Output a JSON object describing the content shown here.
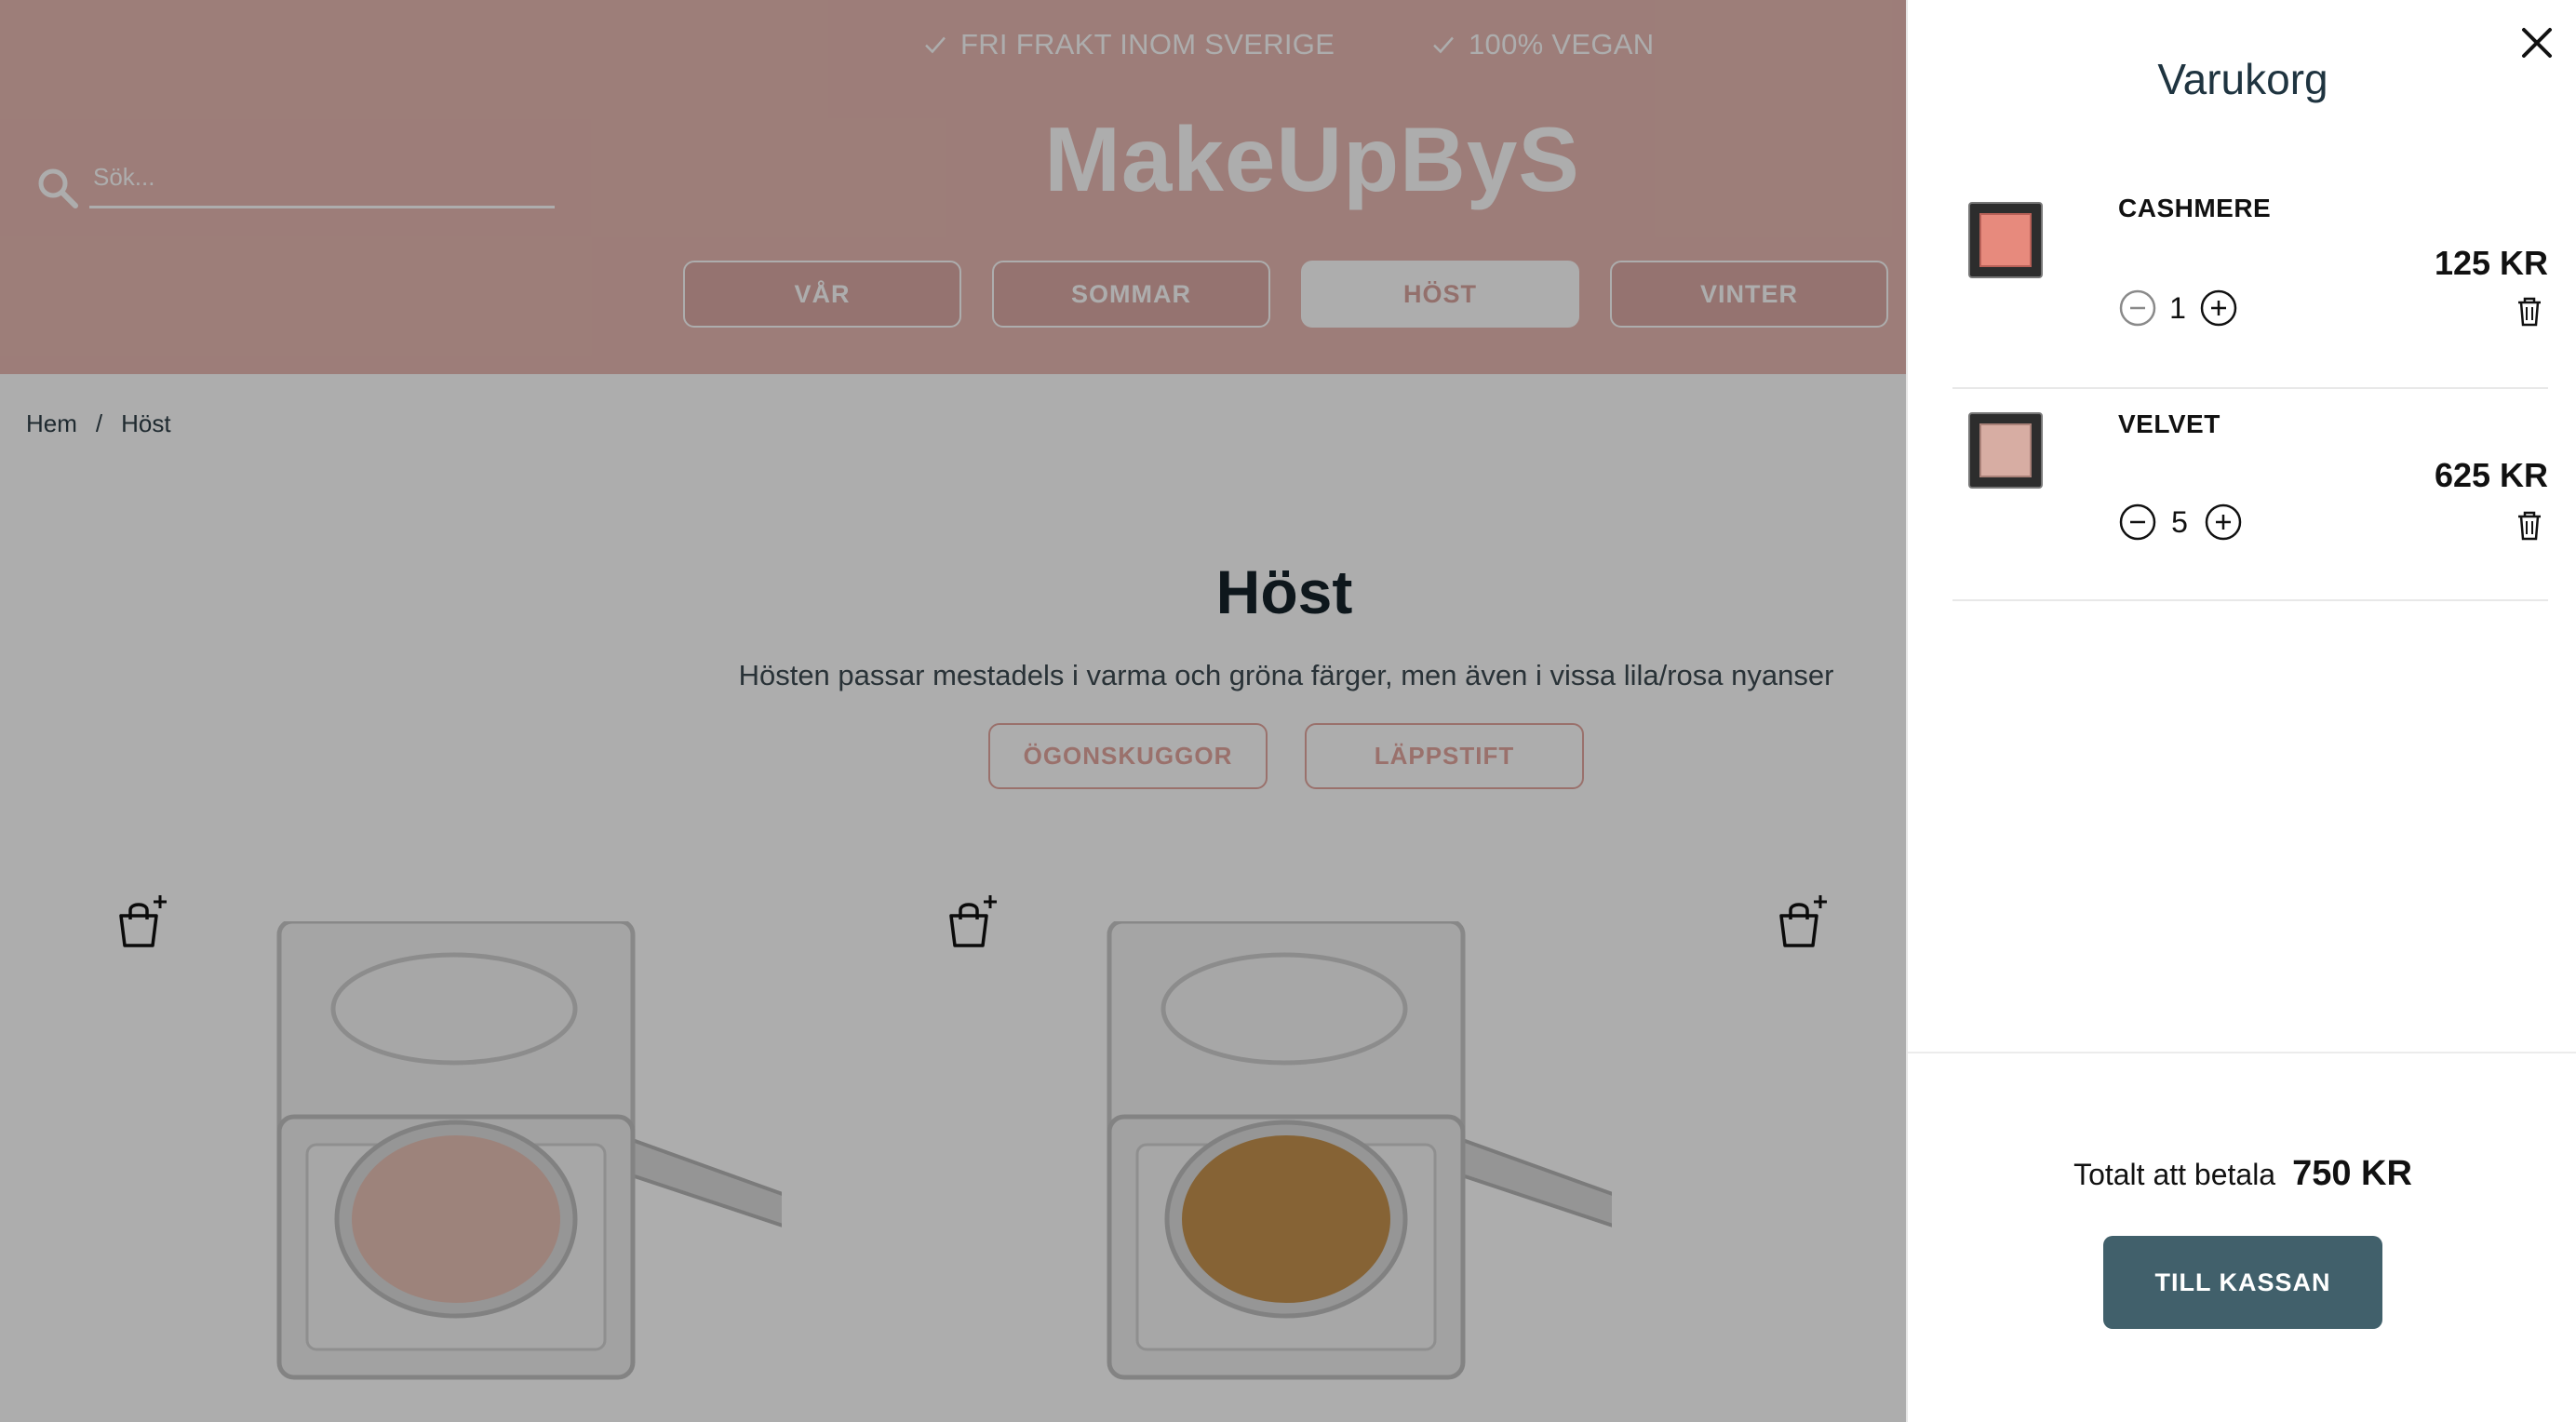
{
  "colors": {
    "header_pink": "#e8b9b3",
    "accent_pink": "#e4a79f",
    "checkout_teal": "#41606b",
    "overlay": "rgba(0,0,0,0.32)"
  },
  "header": {
    "usp": [
      {
        "icon": "check-icon",
        "text": "FRI FRAKT INOM SVERIGE"
      },
      {
        "icon": "check-icon",
        "text": "100% VEGAN"
      }
    ],
    "search_placeholder": "Sök...",
    "logo": "MakeUpByS",
    "seasons": [
      "VÅR",
      "SOMMAR",
      "HÖST",
      "VINTER"
    ],
    "active_season": "HÖST"
  },
  "breadcrumb": {
    "home": "Hem",
    "separator": "/",
    "current": "Höst"
  },
  "main": {
    "title": "Höst",
    "description": "Hösten passar mestadels i varma och gröna färger, men även i vissa lila/rosa nyanser",
    "categories": [
      "ÖGONSKUGGOR",
      "LÄPPSTIFT"
    ],
    "products": [
      {
        "icon": "add-to-bag-icon",
        "pan_color": "#e8c2b6"
      },
      {
        "icon": "add-to-bag-icon",
        "pan_color": "#c6924e"
      },
      {
        "icon": "add-to-bag-icon"
      }
    ]
  },
  "cart": {
    "title": "Varukorg",
    "items": [
      {
        "name": "CASHMERE",
        "price": "125 KR",
        "qty": "1",
        "swatch": "#e78a7d"
      },
      {
        "name": "VELVET",
        "price": "625 KR",
        "qty": "5",
        "swatch": "#d7ada3"
      }
    ],
    "total_label": "Totalt att betala",
    "total_value": "750 KR",
    "checkout_label": "TILL KASSAN"
  }
}
